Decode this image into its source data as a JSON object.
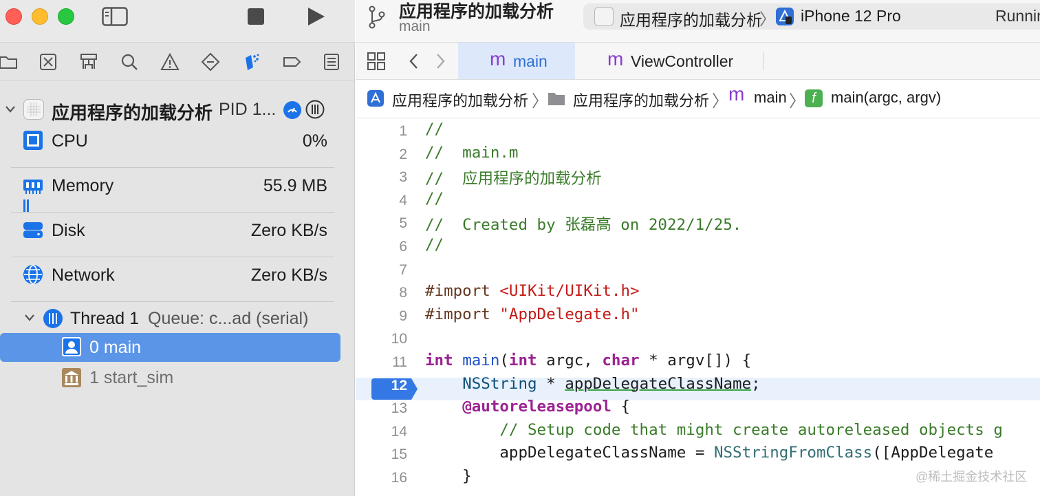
{
  "window": {
    "project_title": "应用程序的加载分析",
    "branch": "main",
    "scheme": "应用程序的加载分析",
    "device": "iPhone 12 Pro",
    "status": "Runnin"
  },
  "navigator": {
    "process": {
      "name": "应用程序的加载分析",
      "pid": "PID 1..."
    },
    "gauges": [
      {
        "label": "CPU",
        "value": "0%",
        "icon": "cpu-icon"
      },
      {
        "label": "Memory",
        "value": "55.9 MB",
        "icon": "memory-icon"
      },
      {
        "label": "Disk",
        "value": "Zero KB/s",
        "icon": "disk-icon"
      },
      {
        "label": "Network",
        "value": "Zero KB/s",
        "icon": "network-icon"
      }
    ],
    "thread": {
      "name": "Thread 1",
      "queue": "Queue: c...ad (serial)"
    },
    "frames": [
      {
        "label": "0 main",
        "icon": "person-frame-icon",
        "selected": true
      },
      {
        "label": "1 start_sim",
        "icon": "library-frame-icon",
        "selected": false
      }
    ]
  },
  "editor": {
    "tabs": [
      {
        "label": "main",
        "active": true
      },
      {
        "label": "ViewController",
        "active": false
      }
    ],
    "breadcrumb": [
      "应用程序的加载分析",
      "应用程序的加载分析",
      "main",
      "main(argc, argv)"
    ],
    "current_line": "12",
    "lines": [
      {
        "n": "1",
        "tokens": [
          {
            "t": "//",
            "c": "com"
          }
        ]
      },
      {
        "n": "2",
        "tokens": [
          {
            "t": "//  main.m",
            "c": "com"
          }
        ]
      },
      {
        "n": "3",
        "tokens": [
          {
            "t": "//  应用程序的加载分析",
            "c": "com"
          }
        ]
      },
      {
        "n": "4",
        "tokens": [
          {
            "t": "//",
            "c": "com"
          }
        ]
      },
      {
        "n": "5",
        "tokens": [
          {
            "t": "//  Created by 张磊高 on 2022/1/25.",
            "c": "com"
          }
        ]
      },
      {
        "n": "6",
        "tokens": [
          {
            "t": "//",
            "c": "com"
          }
        ]
      },
      {
        "n": "7",
        "tokens": []
      },
      {
        "n": "8",
        "tokens": [
          {
            "t": "#import ",
            "c": "pp"
          },
          {
            "t": "<UIKit/UIKit.h>",
            "c": "str"
          }
        ]
      },
      {
        "n": "9",
        "tokens": [
          {
            "t": "#import ",
            "c": "pp"
          },
          {
            "t": "\"AppDelegate.h\"",
            "c": "str"
          }
        ]
      },
      {
        "n": "10",
        "tokens": []
      },
      {
        "n": "11",
        "tokens": [
          {
            "t": "int",
            "c": "kw"
          },
          {
            "t": " ",
            "c": ""
          },
          {
            "t": "main",
            "c": "typ"
          },
          {
            "t": "(",
            "c": ""
          },
          {
            "t": "int",
            "c": "kw"
          },
          {
            "t": " argc, ",
            "c": ""
          },
          {
            "t": "char",
            "c": "kw"
          },
          {
            "t": " * argv[]) {",
            "c": ""
          }
        ]
      },
      {
        "n": "12",
        "tokens": [
          {
            "t": "    ",
            "c": ""
          },
          {
            "t": "NSString",
            "c": "cls"
          },
          {
            "t": " * ",
            "c": ""
          },
          {
            "t": "appDelegateClassName",
            "c": "ul"
          },
          {
            "t": ";",
            "c": ""
          }
        ]
      },
      {
        "n": "13",
        "tokens": [
          {
            "t": "    ",
            "c": ""
          },
          {
            "t": "@autoreleasepool",
            "c": "kw"
          },
          {
            "t": " {",
            "c": ""
          }
        ]
      },
      {
        "n": "14",
        "tokens": [
          {
            "t": "        // Setup code that might create autoreleased objects g",
            "c": "com"
          }
        ]
      },
      {
        "n": "15",
        "tokens": [
          {
            "t": "        appDelegateClassName = ",
            "c": ""
          },
          {
            "t": "NSStringFromClass",
            "c": "fn"
          },
          {
            "t": "([AppDelegate",
            "c": ""
          }
        ]
      },
      {
        "n": "16",
        "tokens": [
          {
            "t": "    }",
            "c": ""
          }
        ]
      }
    ]
  },
  "watermark": "@稀土掘金技术社区"
}
